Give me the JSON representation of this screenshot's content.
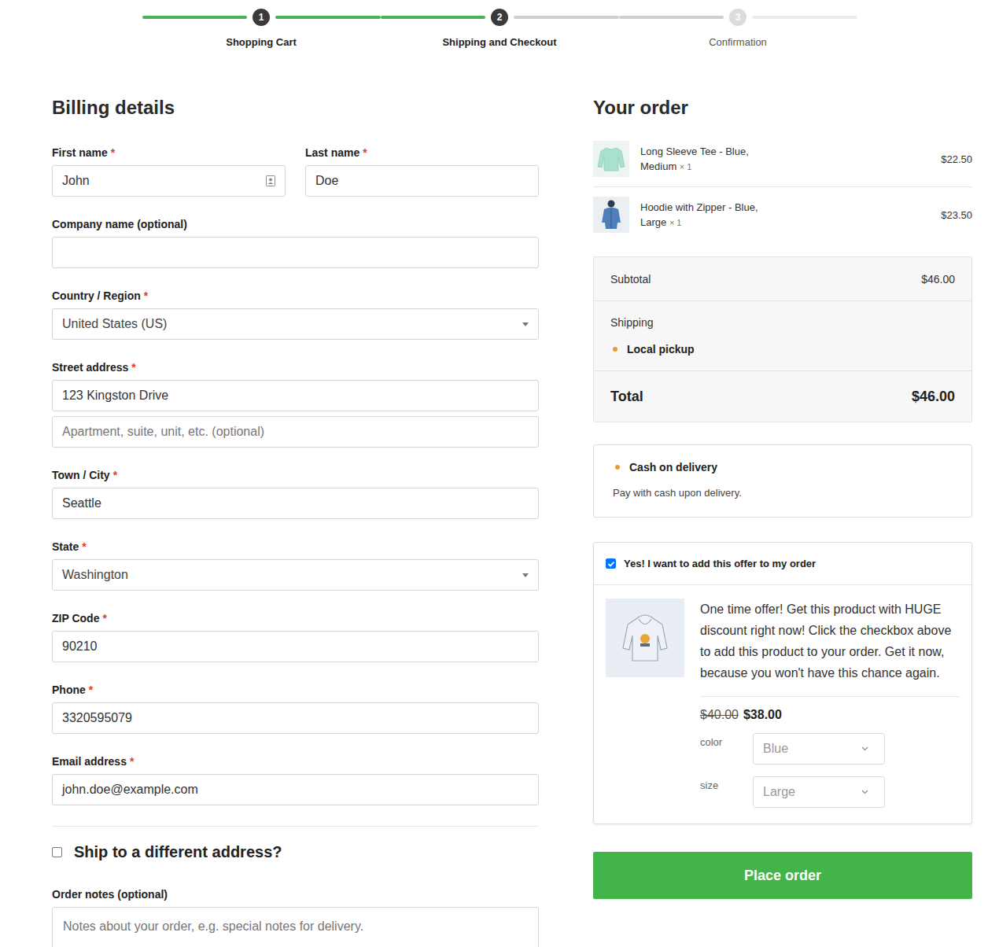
{
  "steps": [
    {
      "number": "1",
      "label": "Shopping Cart",
      "completed": true
    },
    {
      "number": "2",
      "label": "Shipping and Checkout",
      "completed": true
    },
    {
      "number": "3",
      "label": "Confirmation",
      "completed": false
    }
  ],
  "billing": {
    "title": "Billing details",
    "required_mark": "*",
    "rows": [
      [
        {
          "label": "First name",
          "required": true,
          "kind": "text",
          "autofill_icon": true,
          "inputs": [
            {
              "value": "John",
              "placeholder": ""
            }
          ]
        },
        {
          "label": "Last name",
          "required": true,
          "kind": "text",
          "autofill_icon": false,
          "inputs": [
            {
              "value": "Doe",
              "placeholder": ""
            }
          ]
        }
      ],
      [
        {
          "label": "Company name (optional)",
          "required": false,
          "kind": "text",
          "autofill_icon": false,
          "inputs": [
            {
              "value": "",
              "placeholder": ""
            }
          ]
        }
      ],
      [
        {
          "label": "Country / Region",
          "required": true,
          "kind": "select",
          "autofill_icon": false,
          "inputs": [
            {
              "value": "United States (US)",
              "placeholder": ""
            }
          ]
        }
      ],
      [
        {
          "label": "Street address",
          "required": true,
          "kind": "text",
          "autofill_icon": false,
          "inputs": [
            {
              "value": "123 Kingston Drive",
              "placeholder": ""
            },
            {
              "value": "",
              "placeholder": "Apartment, suite, unit, etc. (optional)"
            }
          ]
        }
      ],
      [
        {
          "label": "Town / City",
          "required": true,
          "kind": "text",
          "autofill_icon": false,
          "inputs": [
            {
              "value": "Seattle",
              "placeholder": ""
            }
          ]
        }
      ],
      [
        {
          "label": "State",
          "required": true,
          "kind": "select",
          "autofill_icon": false,
          "inputs": [
            {
              "value": "Washington",
              "placeholder": ""
            }
          ]
        }
      ],
      [
        {
          "label": "ZIP Code",
          "required": true,
          "kind": "text",
          "autofill_icon": false,
          "inputs": [
            {
              "value": "90210",
              "placeholder": ""
            }
          ]
        }
      ],
      [
        {
          "label": "Phone",
          "required": true,
          "kind": "text",
          "autofill_icon": false,
          "inputs": [
            {
              "value": "3320595079",
              "placeholder": ""
            }
          ]
        }
      ],
      [
        {
          "label": "Email address",
          "required": true,
          "kind": "text",
          "autofill_icon": false,
          "inputs": [
            {
              "value": "john.doe@example.com",
              "placeholder": ""
            }
          ]
        }
      ]
    ],
    "ship_different": {
      "label": "Ship to a different address?",
      "checked": false
    },
    "order_notes": {
      "label": "Order notes (optional)",
      "placeholder": "Notes about your order, e.g. special notes for delivery."
    }
  },
  "order": {
    "title": "Your order",
    "items": [
      {
        "name": "Long Sleeve Tee - Blue, Medium",
        "quantity": "× 1",
        "price": "$22.50",
        "kind": "tee"
      },
      {
        "name": "Hoodie with Zipper - Blue, Large",
        "quantity": "× 1",
        "price": "$23.50",
        "kind": "hoodie"
      }
    ],
    "subtotal": {
      "label": "Subtotal",
      "value": "$46.00"
    },
    "shipping": {
      "label": "Shipping",
      "options": [
        {
          "label": "Local pickup",
          "selected": true
        }
      ]
    },
    "total": {
      "label": "Total",
      "value": "$46.00"
    }
  },
  "payment": {
    "methods": [
      {
        "label": "Cash on delivery",
        "description": "Pay with cash upon delivery.",
        "selected": true
      }
    ]
  },
  "offer": {
    "checkbox_label": "Yes! I want to add this offer to my order",
    "checked": true,
    "description": "One time offer! Get this product with HUGE discount right now! Click the checkbox above to add this product to your order. Get it now, because you won't have this chance again.",
    "old_price": "$40.00",
    "new_price": "$38.00",
    "attributes": [
      {
        "label": "color",
        "value": "Blue"
      },
      {
        "label": "size",
        "value": "Large"
      }
    ]
  },
  "place_order": {
    "label": "Place order"
  }
}
